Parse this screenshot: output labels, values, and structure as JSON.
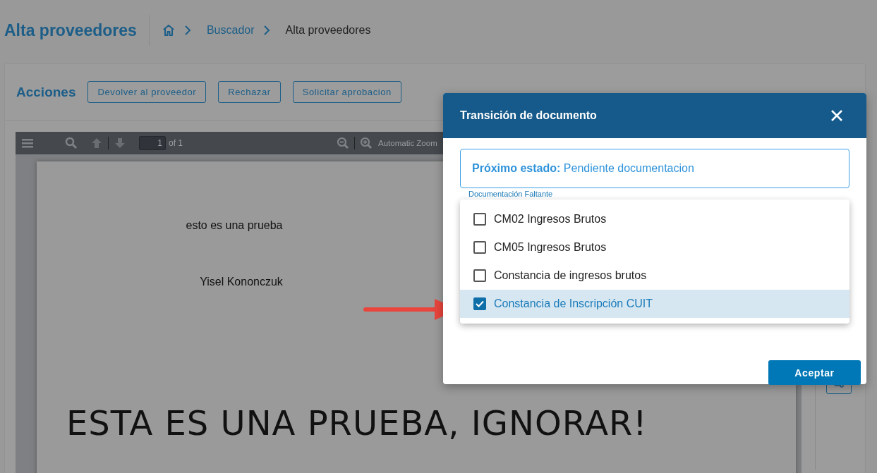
{
  "header": {
    "title": "Alta proveedores",
    "breadcrumb": [
      {
        "label": "Buscador",
        "current": false
      },
      {
        "label": "Alta proveedores",
        "current": true
      }
    ]
  },
  "actions": {
    "title": "Acciones",
    "buttons": [
      "Devolver al proveedor",
      "Rechazar",
      "Solicitar aprobacion"
    ]
  },
  "pdf_viewer": {
    "page_number": "1",
    "page_count": "of 1",
    "zoom": "Automatic Zoom",
    "lines": [
      "esto es una prueba",
      "Yisel Kononczuk"
    ],
    "heading": "ESTA ES UNA PRUEBA, IGNORAR!"
  },
  "dialog": {
    "title": "Transición de documento",
    "next_state_label": "Próximo estado:",
    "next_state_value": "Pendiente documentacion",
    "field_label": "Documentación Faltante",
    "options": [
      {
        "label": "CM02 Ingresos Brutos",
        "checked": false
      },
      {
        "label": "CM05 Ingresos Brutos",
        "checked": false
      },
      {
        "label": "Constancia de ingresos brutos",
        "checked": false
      },
      {
        "label": "Constancia de Inscripción CUIT",
        "checked": true
      }
    ],
    "accept": "Aceptar"
  }
}
